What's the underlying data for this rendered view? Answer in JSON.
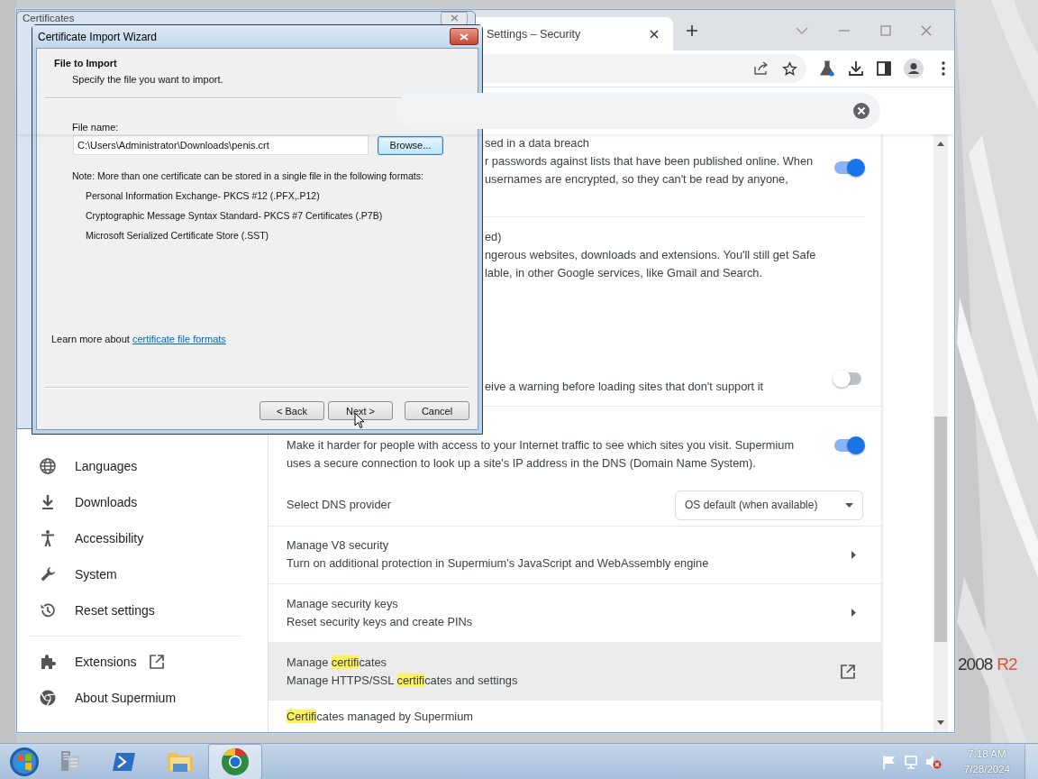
{
  "desktop": {
    "brand": [
      {
        "text": "2008",
        "kind": "plain"
      },
      {
        "text": "R2",
        "kind": "accent"
      }
    ]
  },
  "certificates_window": {
    "title": "Certificates"
  },
  "wizard": {
    "title": "Certificate Import Wizard",
    "heading": "File to Import",
    "subheading": "Specify the file you want to import.",
    "file_label": "File name:",
    "file_value": "C:\\Users\\Administrator\\Downloads\\penis.crt",
    "browse": {
      "label": "Browse...",
      "focused": true
    },
    "note": "Note:  More than one certificate can be stored in a single file in the following formats:",
    "formats": [
      "Personal Information Exchange- PKCS #12 (.PFX,.P12)",
      "Cryptographic Message Syntax Standard- PKCS #7 Certificates (.P7B)",
      "Microsoft Serialized Certificate Store (.SST)"
    ],
    "learn_more": {
      "text": "Learn more about ",
      "link": "certificate file formats"
    },
    "buttons": [
      {
        "label": "< Back"
      },
      {
        "label": "Next >"
      },
      {
        "label": "Cancel"
      }
    ]
  },
  "browser": {
    "tab": {
      "title": "Settings – Security"
    },
    "sidebar": {
      "items": [
        {
          "label": "Languages",
          "external": false
        },
        {
          "label": "Downloads",
          "external": false
        },
        {
          "label": "Accessibility",
          "external": false
        },
        {
          "label": "System",
          "external": false
        },
        {
          "label": "Reset settings",
          "external": false
        },
        {
          "label": "Extensions",
          "external": true
        },
        {
          "label": "About Supermium",
          "external": false
        }
      ]
    },
    "rows": [
      {
        "kind": "toggle",
        "on": true,
        "title": "sed in a data breach",
        "lines": [
          "r passwords against lists that have been published online. When",
          "usernames are encrypted, so they can't be read by anyone,"
        ]
      },
      {
        "kind": "plain",
        "title": "ed)",
        "lines": [
          "ngerous websites, downloads and extensions. You'll still get Safe",
          "lable, in other Google services, like Gmail and Search."
        ]
      },
      {
        "kind": "toggle",
        "on": false,
        "lines": [
          "eive a warning before loading sites that don't support it"
        ]
      },
      {
        "kind": "toggle",
        "on": true,
        "lines": [
          "Make it harder for people with access to your Internet traffic to see which sites you visit. Supermium",
          "uses a secure connection to look up a site's IP address in the DNS (Domain Name System)."
        ]
      },
      {
        "kind": "select",
        "title": "Select DNS provider",
        "value": "OS default (when available)"
      },
      {
        "kind": "arrow",
        "hovered": false,
        "title": "Manage V8 security",
        "lines": [
          "Turn on additional protection in Supermium's JavaScript and WebAssembly engine"
        ]
      },
      {
        "kind": "arrow",
        "hovered": false,
        "title": "Manage security keys",
        "lines": [
          "Reset security keys and create PINs"
        ]
      },
      {
        "kind": "external",
        "hovered": true,
        "title": [
          {
            "text": "Manage "
          },
          {
            "text": "certifi",
            "highlight": true
          },
          {
            "text": "cates"
          }
        ],
        "lines": [
          [
            {
              "text": "Manage HTTPS/SSL "
            },
            {
              "text": "certifi",
              "highlight": true
            },
            {
              "text": "cates and settings"
            }
          ]
        ]
      },
      {
        "kind": "plain",
        "title": [
          {
            "text": "Certifi",
            "highlight": true
          },
          {
            "text": "cates managed by Supermium"
          }
        ]
      }
    ]
  },
  "taskbar": {
    "clock": {
      "time": "7:18 AM",
      "date": "7/28/2024"
    }
  }
}
